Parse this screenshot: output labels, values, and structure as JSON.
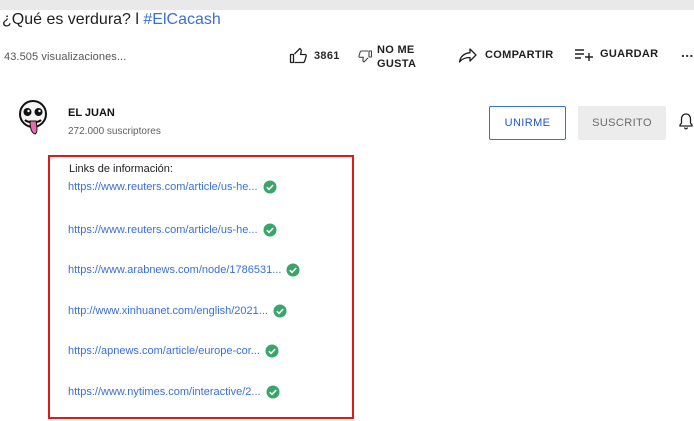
{
  "video": {
    "title_text": "¿Qué es verdura? l ",
    "title_hashtag": "#ElCacash",
    "views": "43.505 visualizaciones..."
  },
  "actions": {
    "like_count": "3861",
    "like_icon": "thumb-up-icon",
    "dislike_line1": "NO ME",
    "dislike_line2": "GUSTA",
    "dislike_icon": "thumb-down-icon",
    "share_label": "COMPARTIR",
    "share_icon": "share-icon",
    "save_label": "GUARDAR",
    "save_icon": "playlist-add-icon",
    "more": "..."
  },
  "channel": {
    "name": "EL JUAN",
    "subscribers": "272.000 suscriptores",
    "join_label": "UNIRME",
    "subscribed_label": "SUSCRITO",
    "bell_icon": "bell-icon"
  },
  "description": {
    "heading": "Links de información:",
    "links": [
      "https://www.reuters.com/article/us-he...",
      "https://www.reuters.com/article/us-he...",
      "https://www.arabnews.com/node/1786531...",
      "http://www.xinhuanet.com/english/2021...",
      "https://apnews.com/article/europe-cor...",
      "https://www.nytimes.com/interactive/2..."
    ],
    "verified_icon": "verified-check-icon"
  },
  "colors": {
    "link": "#3b6fd6",
    "highlight_border": "#e01a1a",
    "check": "#3aa56b"
  }
}
